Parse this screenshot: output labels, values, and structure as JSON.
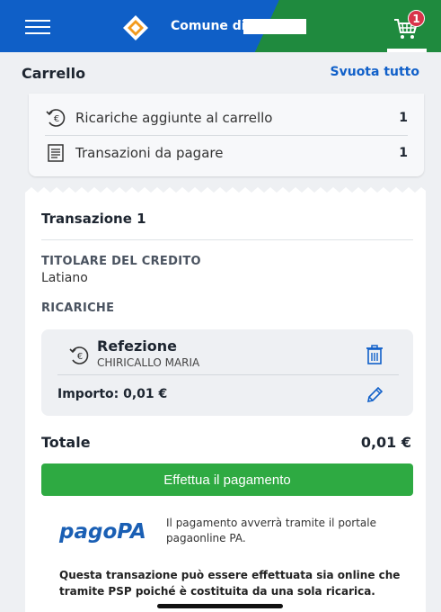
{
  "header": {
    "town_label": "Comune di",
    "cart_count": "1"
  },
  "cart": {
    "title": "Carrello",
    "clear_label": "Svuota tutto"
  },
  "summary": [
    {
      "label": "Ricariche aggiunte al carrello",
      "value": "1",
      "icon": "euro-recharge-icon"
    },
    {
      "label": "Transazioni da pagare",
      "value": "1",
      "icon": "document-list-icon"
    }
  ],
  "transaction": {
    "title": "Transazione 1",
    "owner_label": "TITOLARE DEL CREDITO",
    "owner_value": "Latiano",
    "recharges_label": "RICARICHE",
    "item": {
      "name": "Refezione",
      "person": "CHIRICALLO MARIA",
      "amount": "Importo: 0,01 €"
    },
    "total_label": "Totale",
    "total_value": "0,01 €",
    "pay_label": "Effettua il pagamento"
  },
  "pagopa": {
    "info": "Il pagamento avverrà tramite il portale pagaonline PA."
  },
  "note": "Questa transazione può essere effettuata sia online che tramite PSP poiché è costituita da una sola ricarica.",
  "colors": {
    "header_blue": "#0f5fc7",
    "header_green": "#1f8a3e",
    "accent_link": "#1060c9",
    "pay_green": "#2eaa42",
    "badge_red": "#d8344b"
  }
}
